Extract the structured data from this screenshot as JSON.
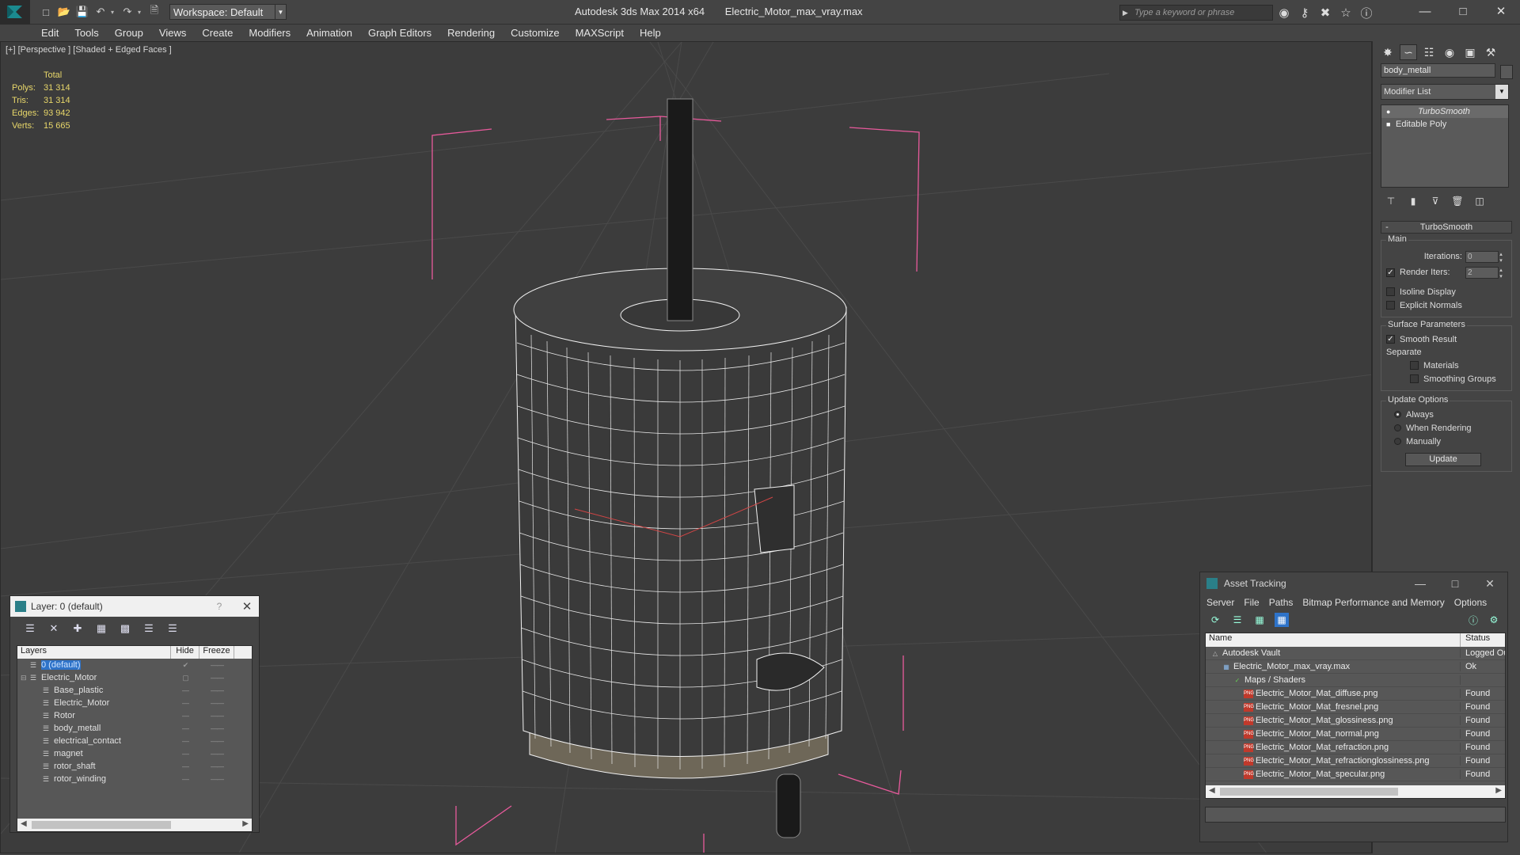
{
  "titlebar": {
    "workspace": "Workspace: Default",
    "app_name": "Autodesk 3ds Max  2014 x64",
    "file_name": "Electric_Motor_max_vray.max",
    "search_placeholder": "Type a keyword or phrase",
    "icons": [
      "binoculars-icon",
      "key-icon",
      "sign-in-icon",
      "star-icon",
      "help-icon"
    ]
  },
  "menubar": {
    "items": [
      "Edit",
      "Tools",
      "Group",
      "Views",
      "Create",
      "Modifiers",
      "Animation",
      "Graph Editors",
      "Rendering",
      "Customize",
      "MAXScript",
      "Help"
    ]
  },
  "viewport": {
    "label": "[+] [Perspective ] [Shaded + Edged Faces ]",
    "stats": {
      "header": "Total",
      "rows": [
        {
          "k": "Polys:",
          "v": "31 314"
        },
        {
          "k": "Tris:",
          "v": "31 314"
        },
        {
          "k": "Edges:",
          "v": "93 942"
        },
        {
          "k": "Verts:",
          "v": "15 665"
        }
      ]
    },
    "colors": {
      "background": "#3c3c3c",
      "grid": "#4b4b4b",
      "bbox": "#e85a9c",
      "wire": "#f0f0f0"
    }
  },
  "command_panel": {
    "object_name": "body_metall",
    "modifier_list": "Modifier List",
    "stack": [
      {
        "label": "TurboSmooth",
        "selected": true
      },
      {
        "label": "Editable Poly",
        "selected": false
      }
    ],
    "turbosmooth": {
      "title": "TurboSmooth",
      "main_label": "Main",
      "iterations_label": "Iterations:",
      "iterations_value": "0",
      "render_iters_label": "Render Iters:",
      "render_iters_value": "2",
      "render_iters_checked": true,
      "isoline_label": "Isoline Display",
      "explicit_normals_label": "Explicit Normals",
      "surface_params_label": "Surface Parameters",
      "smooth_result_label": "Smooth Result",
      "separate_label": "Separate",
      "materials_label": "Materials",
      "smoothing_groups_label": "Smoothing Groups",
      "update_options_label": "Update Options",
      "always_label": "Always",
      "when_rendering_label": "When Rendering",
      "manually_label": "Manually",
      "update_button": "Update"
    }
  },
  "layer_dialog": {
    "title": "Layer: 0 (default)",
    "help": "?",
    "columns": {
      "layers": "Layers",
      "hide": "Hide",
      "freeze": "Freeze"
    },
    "rows": [
      {
        "name": "0 (default)",
        "indent": 0,
        "selected": true,
        "expand": "",
        "hide_mark": "✔"
      },
      {
        "name": "Electric_Motor",
        "indent": 0,
        "selected": false,
        "expand": "⊟",
        "hide_mark": "▢"
      },
      {
        "name": "Base_plastic",
        "indent": 1,
        "selected": false,
        "expand": "",
        "hide_mark": "—"
      },
      {
        "name": "Electric_Motor",
        "indent": 1,
        "selected": false,
        "expand": "",
        "hide_mark": "—"
      },
      {
        "name": "Rotor",
        "indent": 1,
        "selected": false,
        "expand": "",
        "hide_mark": "—"
      },
      {
        "name": "body_metall",
        "indent": 1,
        "selected": false,
        "expand": "",
        "hide_mark": "—"
      },
      {
        "name": "electrical_contact",
        "indent": 1,
        "selected": false,
        "expand": "",
        "hide_mark": "—"
      },
      {
        "name": "magnet",
        "indent": 1,
        "selected": false,
        "expand": "",
        "hide_mark": "—"
      },
      {
        "name": "rotor_shaft",
        "indent": 1,
        "selected": false,
        "expand": "",
        "hide_mark": "—"
      },
      {
        "name": "rotor_winding",
        "indent": 1,
        "selected": false,
        "expand": "",
        "hide_mark": "—"
      }
    ]
  },
  "asset_tracking": {
    "title": "Asset Tracking",
    "menu": [
      "Server",
      "File",
      "Paths",
      "Bitmap Performance and Memory",
      "Options"
    ],
    "columns": {
      "name": "Name",
      "status": "Status"
    },
    "rows": [
      {
        "name": "Autodesk Vault",
        "status": "Logged Out",
        "type": "vault",
        "indent": 0
      },
      {
        "name": "Electric_Motor_max_vray.max",
        "status": "Ok",
        "type": "file",
        "indent": 1
      },
      {
        "name": "Maps / Shaders",
        "status": "",
        "type": "maps",
        "indent": 2
      },
      {
        "name": "Electric_Motor_Mat_diffuse.png",
        "status": "Found",
        "type": "png",
        "indent": 3
      },
      {
        "name": "Electric_Motor_Mat_fresnel.png",
        "status": "Found",
        "type": "png",
        "indent": 3
      },
      {
        "name": "Electric_Motor_Mat_glossiness.png",
        "status": "Found",
        "type": "png",
        "indent": 3
      },
      {
        "name": "Electric_Motor_Mat_normal.png",
        "status": "Found",
        "type": "png",
        "indent": 3
      },
      {
        "name": "Electric_Motor_Mat_refraction.png",
        "status": "Found",
        "type": "png",
        "indent": 3
      },
      {
        "name": "Electric_Motor_Mat_refractionglossiness.png",
        "status": "Found",
        "type": "png",
        "indent": 3
      },
      {
        "name": "Electric_Motor_Mat_specular.png",
        "status": "Found",
        "type": "png",
        "indent": 3
      }
    ]
  }
}
